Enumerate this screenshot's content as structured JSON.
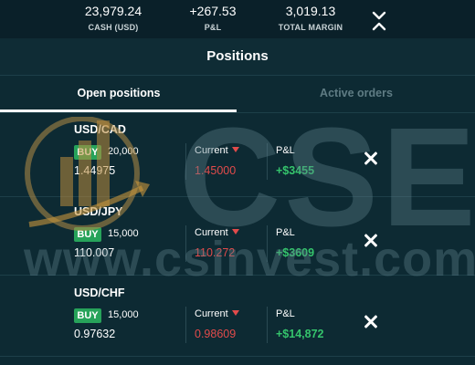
{
  "summary": {
    "cash": {
      "value": "23,979.24",
      "label": "CASH (USD)"
    },
    "pl": {
      "value": "+267.53",
      "label": "P&L"
    },
    "margin": {
      "value": "3,019.13",
      "label": "TOTAL MARGIN"
    },
    "toggle_icon": "collapse-arrows-icon"
  },
  "header": {
    "title": "Positions"
  },
  "tabs": [
    {
      "label": "Open positions",
      "selected": true
    },
    {
      "label": "Active orders",
      "selected": false
    }
  ],
  "positions": [
    {
      "pair": "USD/CAD",
      "side": "BUY",
      "quantity": "20,000",
      "open_price": "1.44975",
      "current_label": "Current",
      "current_price": "1.45000",
      "pl_label": "P&L",
      "pl_value": "+$3455"
    },
    {
      "pair": "USD/JPY",
      "side": "BUY",
      "quantity": "15,000",
      "open_price": "110.007",
      "current_label": "Current",
      "current_price": "110.272",
      "pl_label": "P&L",
      "pl_value": "+$3609"
    },
    {
      "pair": "USD/CHF",
      "side": "BUY",
      "quantity": "15,000",
      "open_price": "0.97632",
      "current_label": "Current",
      "current_price": "0.98609",
      "pl_label": "P&L",
      "pl_value": "+$14,872"
    }
  ],
  "watermark": {
    "brand": "CSE",
    "url": "www.csinvest.com"
  },
  "colors": {
    "background": "#0d2a33",
    "buy": "#27a35a",
    "down": "#e24b4b",
    "profit": "#35c46c"
  }
}
